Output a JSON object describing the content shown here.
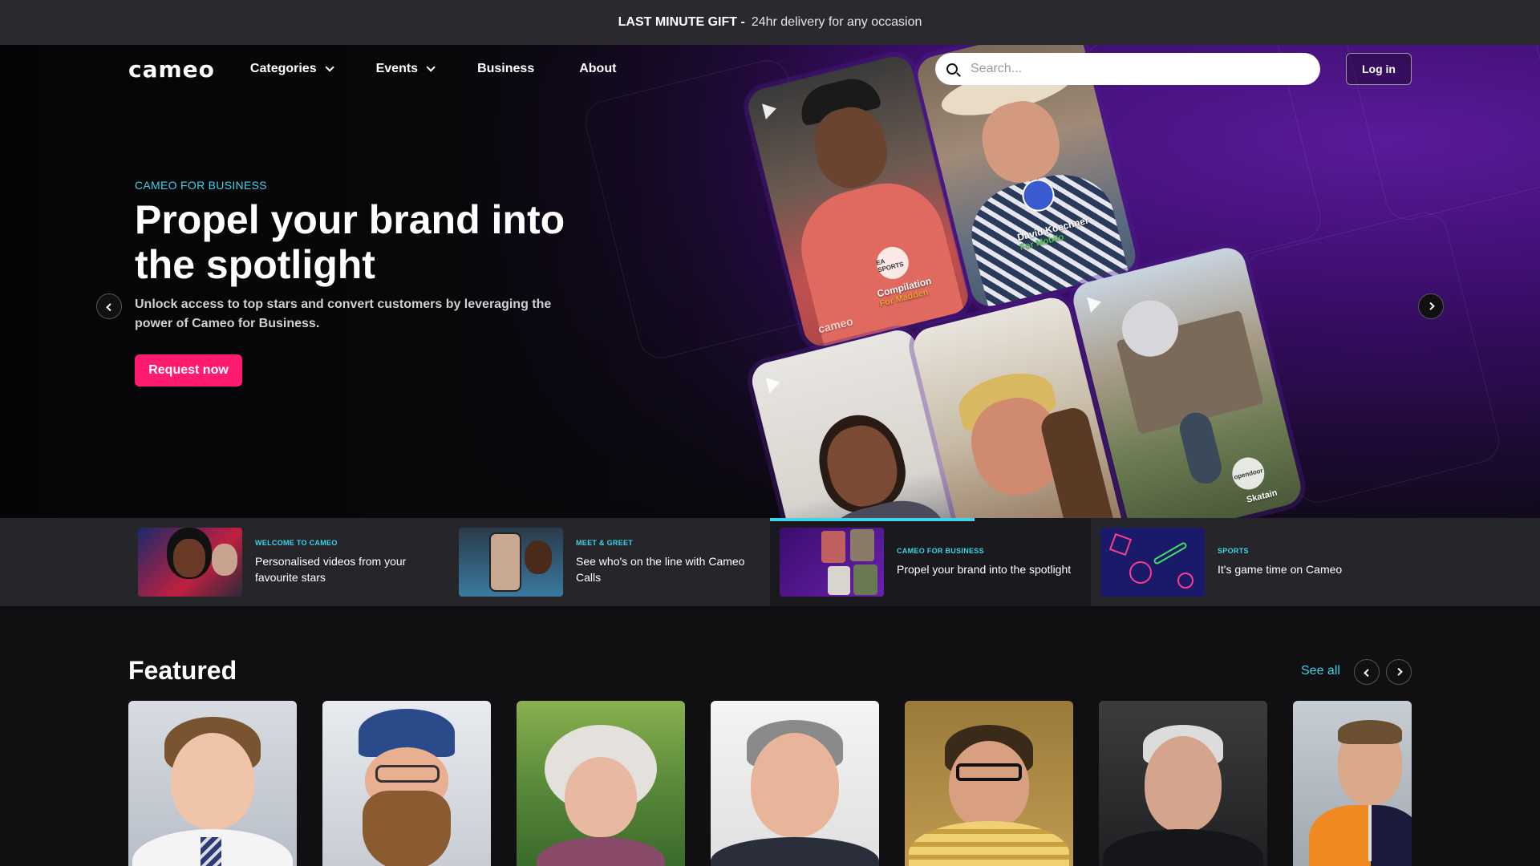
{
  "promo": {
    "bold": "LAST MINUTE GIFT -",
    "text": "24hr delivery for any occasion"
  },
  "nav": {
    "logo": "cameo",
    "items": [
      {
        "label": "Categories",
        "dropdown": true
      },
      {
        "label": "Events",
        "dropdown": true
      },
      {
        "label": "Business",
        "dropdown": false
      },
      {
        "label": "About",
        "dropdown": false
      }
    ],
    "search_placeholder": "Search...",
    "login_label": "Log in"
  },
  "hero": {
    "eyebrow": "CAMEO FOR BUSINESS",
    "title": "Propel your brand into the spotlight",
    "subtitle": "Unlock access to top stars and convert customers by leveraging the power of Cameo for Business.",
    "cta_label": "Request now",
    "cards": [
      {
        "caption": "Compilation",
        "subcaption": "For Madden",
        "badge": "EA SPORTS",
        "watermark": "cameo"
      },
      {
        "caption": "David Koechner",
        "subcaption": "For Mobilo"
      },
      {
        "caption": ""
      },
      {
        "caption": ""
      },
      {
        "caption": "Skatain",
        "badge": "opendoor"
      }
    ]
  },
  "tabs": [
    {
      "kicker": "WELCOME TO CAMEO",
      "title": "Personalised videos from your favourite stars"
    },
    {
      "kicker": "MEET & GREET",
      "title": "See who's on the line with Cameo Calls"
    },
    {
      "kicker": "CAMEO FOR BUSINESS",
      "title": "Propel your brand into the spotlight",
      "active": true
    },
    {
      "kicker": "SPORTS",
      "title": "It's game time on Cameo"
    }
  ],
  "featured": {
    "title": "Featured",
    "see_all": "See all"
  },
  "colors": {
    "accent": "#3ed3e8",
    "cta": "#ff1b6f",
    "promo_bg": "#2a2a2e"
  }
}
